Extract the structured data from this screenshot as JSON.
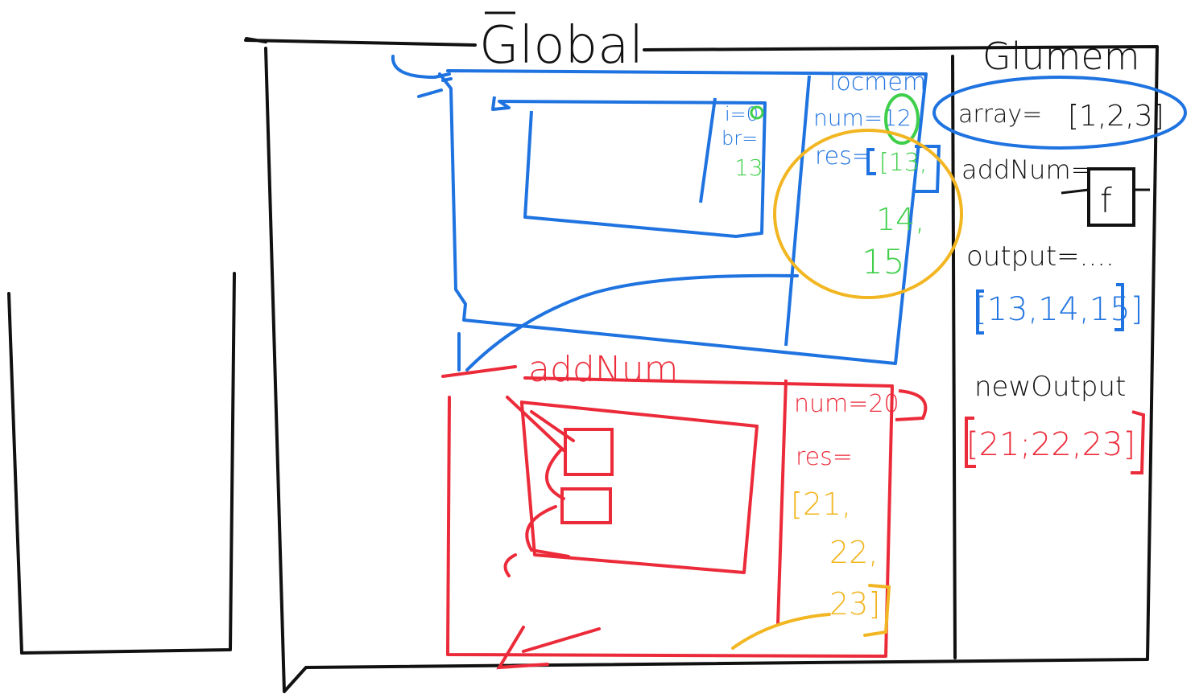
{
  "colors": {
    "ink": "#111111",
    "blue": "#1f73e0",
    "red": "#ec2b3a",
    "green": "#3fcf4a",
    "yellow": "#f2b622",
    "paper": "#ffffff"
  },
  "global": {
    "title": "Global",
    "glo_mem_title": "Glumem",
    "glo_mem": {
      "array_label": "array=",
      "array_value": "[1,2,3]",
      "addnum_label": "addNum=",
      "addnum_value": "f",
      "output_label": "output=....",
      "output_value": "[13,14,15]",
      "newoutput_label": "newOutput",
      "newoutput_value": "[21;22,23]"
    }
  },
  "blue_context": {
    "loc_mem_title": "locmem",
    "num": "num=12",
    "res_label": "res=",
    "res_values": [
      "[13,",
      "14,",
      "15"
    ],
    "inner_i": "i=0",
    "inner_br": "br=",
    "inner_val": "13"
  },
  "red_context": {
    "title": "addNum",
    "num": "num=20",
    "res_label": "res=",
    "res_values": [
      "[21,",
      "22,",
      "23]"
    ]
  }
}
